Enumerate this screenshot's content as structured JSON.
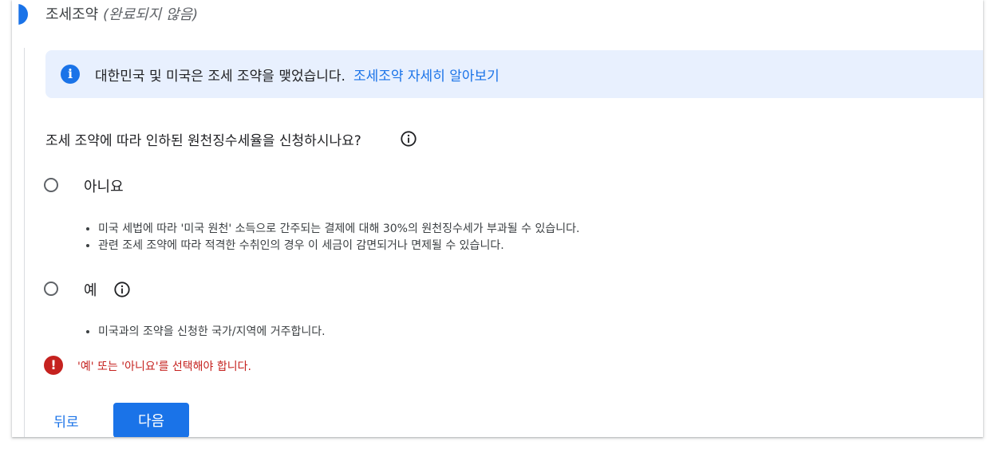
{
  "step": {
    "title": "조세조약",
    "status": "(완료되지 않음)"
  },
  "info_banner": {
    "icon": "info-icon",
    "text": "대한민국 및 미국은 조세 조약을 맺었습니다.",
    "link_label": "조세조약 자세히 알아보기",
    "accent_color": "#1a73e8",
    "background_color": "#e8f0fe"
  },
  "question": {
    "text": "조세 조약에 따라 인하된 원천징수세율을 신청하시나요?",
    "help_icon": "help-info-icon"
  },
  "options": [
    {
      "label": "아니요",
      "selected": false,
      "bullets": [
        "미국 세법에 따라 '미국 원천' 소득으로 간주되는 결제에 대해 30%의 원천징수세가 부과될 수 있습니다.",
        "관련 조세 조약에 따라 적격한 수취인의 경우 이 세금이 감면되거나 면제될 수 있습니다."
      ]
    },
    {
      "label": "예",
      "selected": false,
      "help_icon": "help-info-icon",
      "bullets": [
        "미국과의 조약을 신청한 국가/지역에 거주합니다."
      ]
    }
  ],
  "error": {
    "icon": "error-icon",
    "text": "'예' 또는 '아니요'를 선택해야 합니다.",
    "color": "#c5221f"
  },
  "actions": {
    "back_label": "뒤로",
    "next_label": "다음"
  }
}
